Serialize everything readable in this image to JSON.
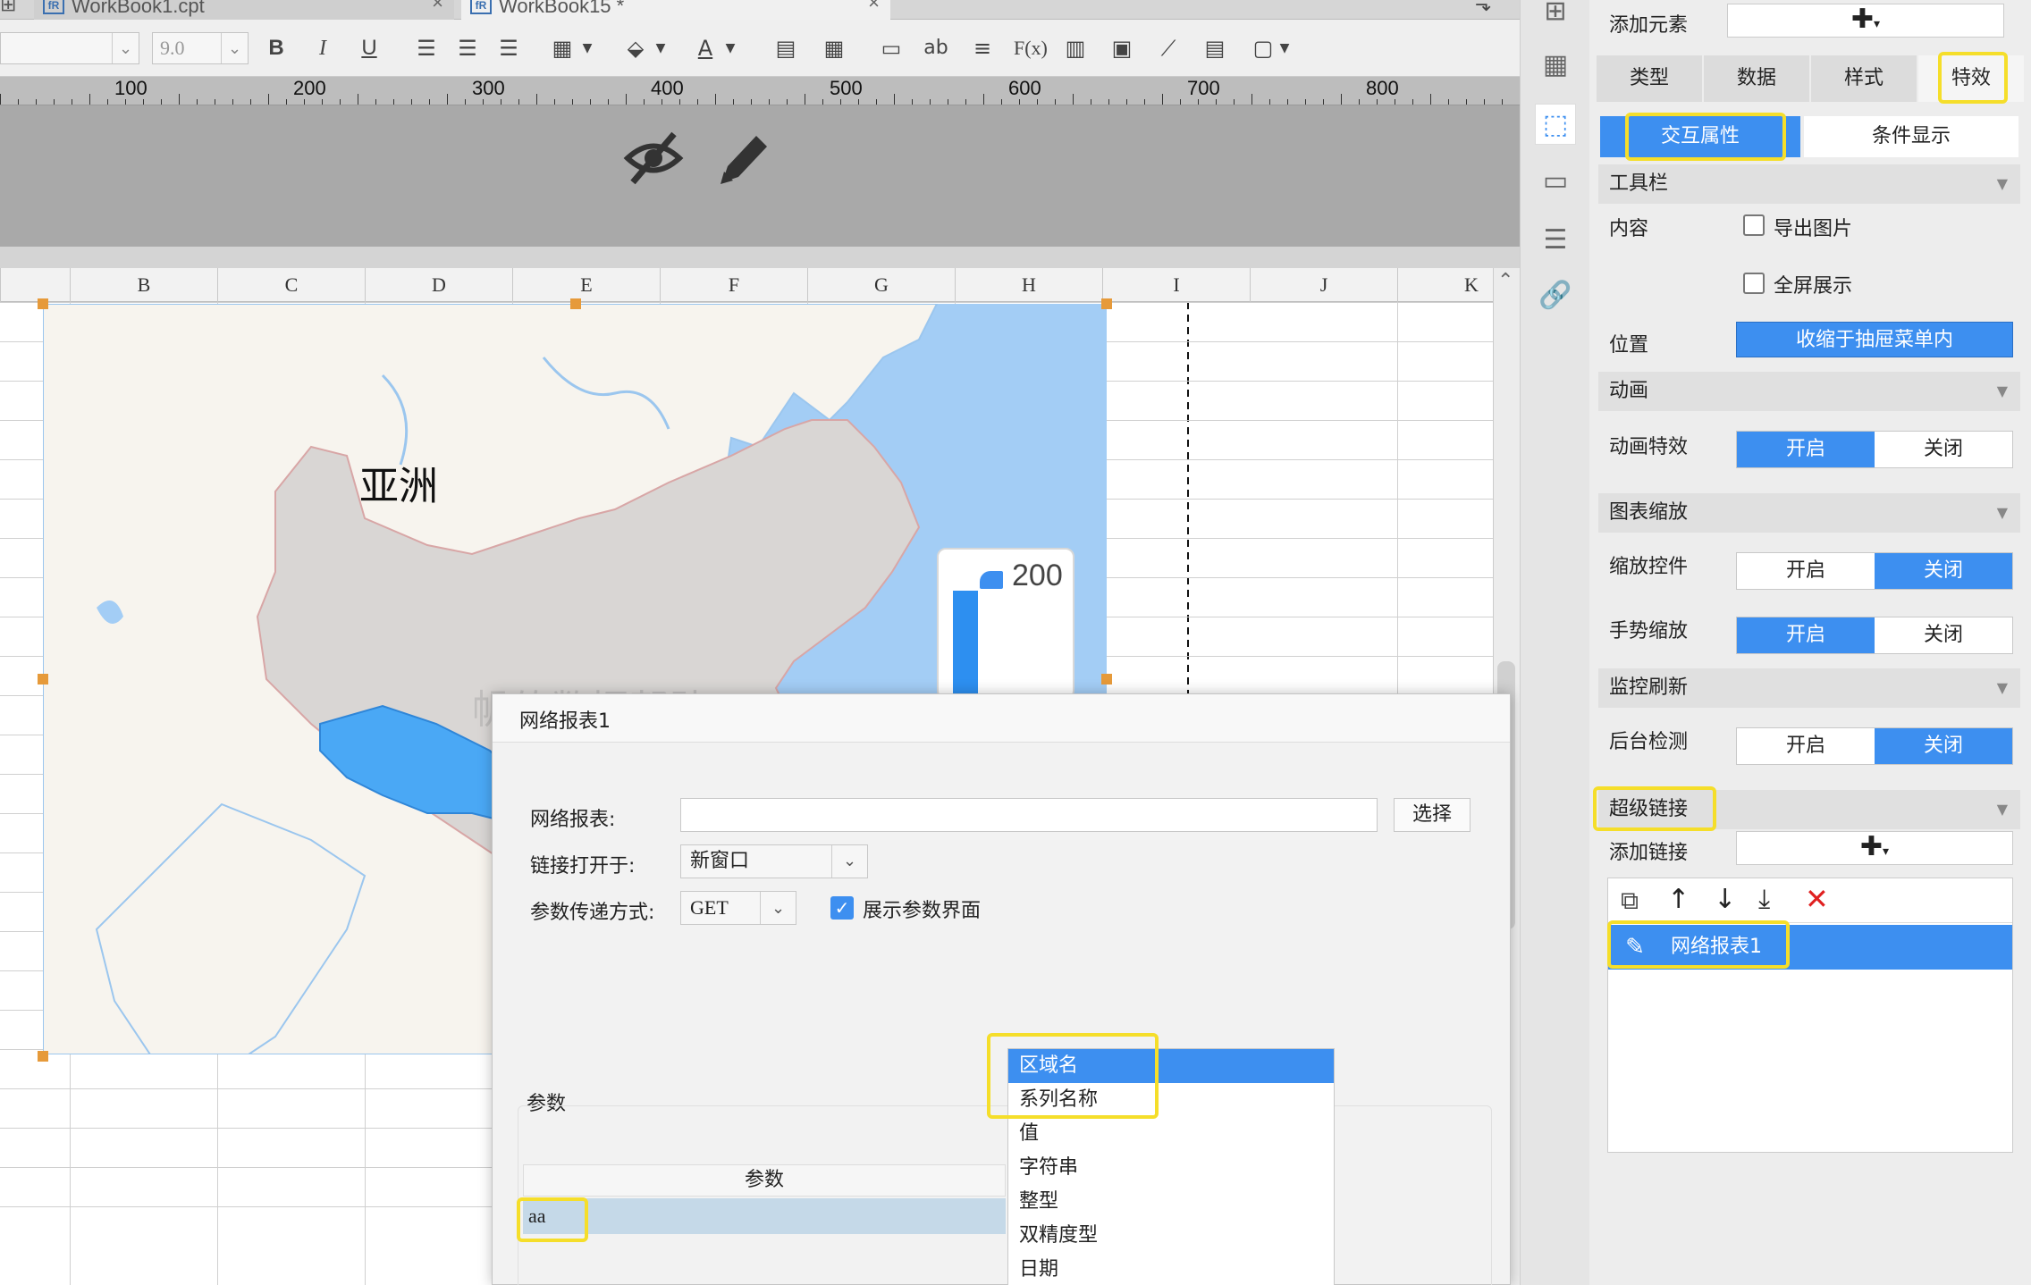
{
  "tabs": [
    {
      "label": "WorkBook1.cpt",
      "icon": "cpt-file-icon"
    },
    {
      "label": "WorkBook15 *",
      "icon": "cpt-file-icon"
    }
  ],
  "toolbar": {
    "font_size": "9.0",
    "buttons": [
      "bold-icon",
      "italic-icon",
      "underline-icon",
      "align-left-icon",
      "align-center-icon",
      "align-right-icon",
      "border-icon",
      "fill-icon",
      "font-color-icon",
      "merge-icon",
      "split-icon",
      "textfield-icon",
      "text-icon",
      "paragraph-icon",
      "formula-icon",
      "chart-icon",
      "image-icon",
      "slash-icon",
      "subreport-icon",
      "frame-icon"
    ],
    "bold": "B",
    "italic": "I",
    "underline": "U",
    "text_glyph": "ab",
    "formula_glyph": "F(x)"
  },
  "ruler": {
    "marks": [
      "100",
      "200",
      "300",
      "400",
      "500",
      "600",
      "700",
      "800"
    ]
  },
  "canvas_icons": [
    "hide-icon",
    "edit-pencil-icon"
  ],
  "sheet": {
    "columns": [
      "B",
      "C",
      "D",
      "E",
      "F",
      "G",
      "H",
      "I",
      "J",
      "K"
    ]
  },
  "map": {
    "label": "亚洲",
    "legend_value": "200",
    "watermark": "帆软数据帮助",
    "colors": {
      "sea": "#a3cdf5",
      "land": "#f7f4ee",
      "region": "#d9d6d4",
      "highlight": "#4aa8f5"
    }
  },
  "dialog": {
    "title": "网络报表1",
    "report_label": "网络报表:",
    "report_value": "",
    "select_button": "选择",
    "open_in_label": "链接打开于:",
    "open_in_value": "新窗口",
    "param_method_label": "参数传递方式:",
    "param_method_value": "GET",
    "show_params_label": "展示参数界面",
    "show_params_checked": true,
    "params_section": "参数",
    "params_header": "参数",
    "param_row_name": "aa",
    "dropdown_options": [
      "区域名",
      "系列名称",
      "值",
      "字符串",
      "整型",
      "双精度型",
      "日期"
    ],
    "dropdown_selected": "区域名"
  },
  "panel": {
    "add_element_label": "添加元素",
    "tabs": [
      "类型",
      "数据",
      "样式",
      "特效"
    ],
    "active_tab": "特效",
    "subtabs": [
      "交互属性",
      "条件显示"
    ],
    "active_subtab": "交互属性",
    "toolbar_section": "工具栏",
    "content_label": "内容",
    "export_image": "导出图片",
    "fullscreen": "全屏展示",
    "position_label": "位置",
    "position_value": "收缩于抽屉菜单内",
    "animation_section": "动画",
    "animation_label": "动画特效",
    "zoom_section": "图表缩放",
    "zoom_control_label": "缩放控件",
    "gesture_zoom_label": "手势缩放",
    "monitor_section": "监控刷新",
    "background_check_label": "后台检测",
    "on_label": "开启",
    "off_label": "关闭",
    "hyperlink_section": "超级链接",
    "add_link_label": "添加链接",
    "link_item": "网络报表1"
  },
  "accent": "#3d8ff0",
  "highlight_color": "#f5de2a"
}
